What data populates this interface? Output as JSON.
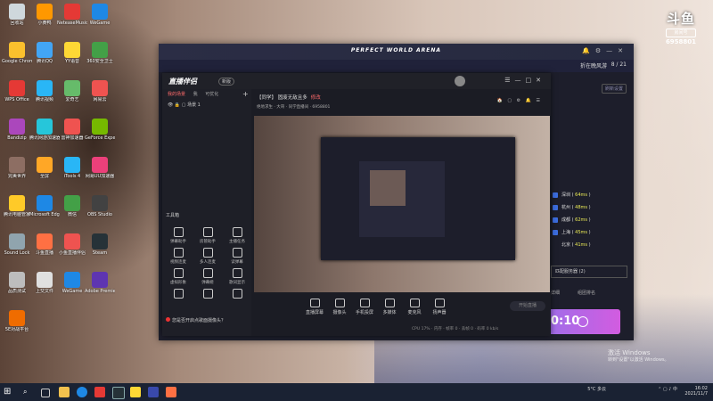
{
  "desktop": {
    "icons": [
      {
        "label": "回收站",
        "color": "#cfd8dc"
      },
      {
        "label": "小黄鸭",
        "color": "#ff9800"
      },
      {
        "label": "NeteaseMusic",
        "color": "#e53935"
      },
      {
        "label": "WeGame",
        "color": "#1e88e5"
      },
      {
        "label": "Google Chrome",
        "color": "#fbc02d"
      },
      {
        "label": "腾讯QQ",
        "color": "#42a5f5"
      },
      {
        "label": "YY语音",
        "color": "#fdd835"
      },
      {
        "label": "360安全卫士",
        "color": "#43a047"
      },
      {
        "label": "WPS Office",
        "color": "#e53935"
      },
      {
        "label": "腾讯视频",
        "color": "#29b6f6"
      },
      {
        "label": "爱奇艺",
        "color": "#66bb6a"
      },
      {
        "label": "网易云",
        "color": "#ef5350"
      },
      {
        "label": "Bandizip",
        "color": "#ab47bc"
      },
      {
        "label": "腾讯网游加速器",
        "color": "#26c6da"
      },
      {
        "label": "雷神加速器",
        "color": "#ef5350"
      },
      {
        "label": "GeForce Experience",
        "color": "#76b900"
      },
      {
        "label": "完美世界",
        "color": "#8d6e63"
      },
      {
        "label": "全屏",
        "color": "#ffa726"
      },
      {
        "label": "iTools 4",
        "color": "#29b6f6"
      },
      {
        "label": "网易UU加速器",
        "color": "#ec407a"
      },
      {
        "label": "腾讯电脑管家",
        "color": "#ffca28"
      },
      {
        "label": "Microsoft Edge",
        "color": "#1e88e5"
      },
      {
        "label": "微信",
        "color": "#43a047"
      },
      {
        "label": "OBS Studio",
        "color": "#424242"
      },
      {
        "label": "Sound Lock",
        "color": "#90a4ae"
      },
      {
        "label": "斗鱼直播",
        "color": "#ff7043"
      },
      {
        "label": "小鱼直播伴侣",
        "color": "#ef5350"
      },
      {
        "label": "Steam",
        "color": "#263238"
      },
      {
        "label": "品质测试",
        "color": "#bdbdbd"
      },
      {
        "label": "上交文件",
        "color": "#e0e0e0"
      },
      {
        "label": "WeGame",
        "color": "#1e88e5"
      },
      {
        "label": "Adobe Premiere",
        "color": "#5e35b1"
      },
      {
        "label": "5E对战平台",
        "color": "#ef6c00"
      }
    ]
  },
  "watermark": {
    "logo": "斗鱼",
    "badge": "房间号",
    "room": "6958801"
  },
  "launcher": {
    "brand": "PERFECT WORLD ARENA",
    "user": "折在晚风游",
    "count": "8 / 21",
    "refresh": "刷新设置",
    "servers": [
      {
        "name": "深圳",
        "ms": "64ms"
      },
      {
        "name": "杭州",
        "ms": "48ms"
      },
      {
        "name": "成都",
        "ms": "62ms"
      },
      {
        "name": "上海",
        "ms": "45ms"
      },
      {
        "name": "北京",
        "ms": "41ms"
      }
    ],
    "server_select": "匹配服务器 (2)",
    "link_a": "详细",
    "link_b": "组团排名",
    "timer": "0:10",
    "low_a": "",
    "low_b": ""
  },
  "assistant": {
    "logo": "直播伴侣",
    "version": "新版",
    "tabs": [
      "我的场景",
      "我",
      "可优化"
    ],
    "scene": "场景 1",
    "tools_title": "工具箱",
    "tools": [
      "弹幕助手",
      "房管助手",
      "主播任务",
      "视频连麦",
      "多人连麦",
      "读弹幕",
      "虚拟形象",
      "弹幕姬",
      "歌词显示",
      "",
      "",
      ""
    ],
    "hint": "您是否开启点歌面摄像头？",
    "room_title": "【同学】 固废无敌且多",
    "room_edit": "修改",
    "room_info": "绝地求生 · 大哥 · 同学直播间 · 6958801",
    "controls": [
      "直播屏幕",
      "摄像头",
      "手机投屏",
      "多媒体",
      "麦克风",
      "扬声器"
    ],
    "go_live": "开始直播",
    "status": "CPU 17% · 内存 · 帧率 0 · 丢帧 0 · 码率 0 kb/s"
  },
  "taskbar": {
    "weather": "5°C 多云",
    "time": "16:02",
    "date": "2021/11/7"
  },
  "activation": {
    "line1": "激活 Windows",
    "line2": "转到\"设置\"以激活 Windows。"
  }
}
